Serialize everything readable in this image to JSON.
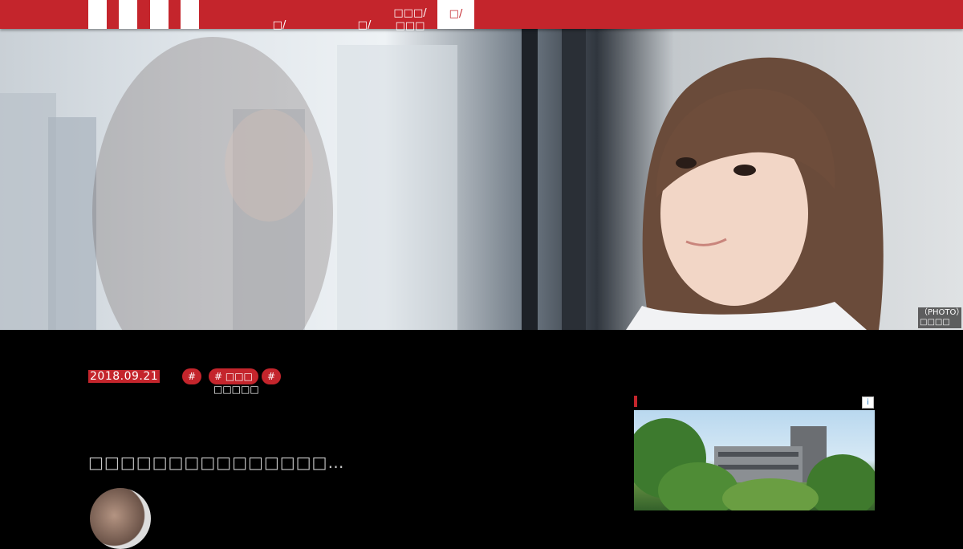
{
  "nav": {
    "items": [
      {
        "label": "□/"
      },
      {
        "label": "□/"
      },
      {
        "label": "□□□/\n□□□"
      }
    ],
    "active": {
      "label": "□/"
    }
  },
  "hero": {
    "photo_credit": "（PHOTO）\n□□□□"
  },
  "article": {
    "date": "2018.09.21",
    "tags": [
      {
        "label": "#"
      },
      {
        "label": "# □□□"
      },
      {
        "label": "#"
      }
    ],
    "tag_sub": "□□□□□",
    "title": "□□□□□□□□□□□□□□□…"
  },
  "ad": {
    "info_icon": "i"
  },
  "colors": {
    "brand": "#c4252c",
    "background": "#000000"
  }
}
